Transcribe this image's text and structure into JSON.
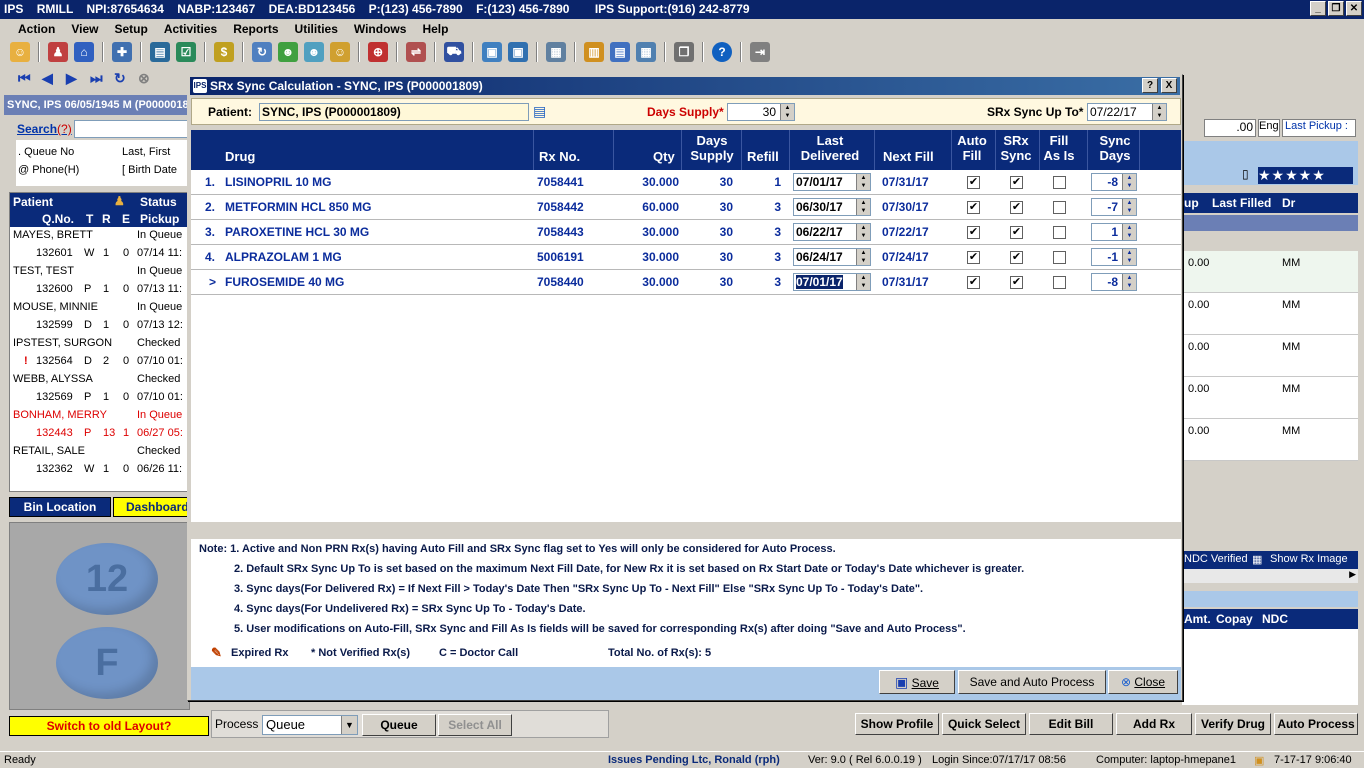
{
  "app": {
    "title_segments": [
      "IPS",
      "RMILL",
      "NPI:87654634",
      "NABP:123467",
      "DEA:BD123456",
      "P:(123) 456-7890",
      "F:(123) 456-7890",
      "IPS Support:(916) 242-8779"
    ],
    "menu": [
      "Action",
      "View",
      "Setup",
      "Activities",
      "Reports",
      "Utilities",
      "Windows",
      "Help"
    ],
    "patient_bar": "SYNC, IPS  06/05/1945 M  (P000001809)",
    "search_label": "Search",
    "search_qmark": "(?)",
    "search_options": [
      ". Queue No",
      "Last, First",
      "@ Phone(H)",
      "[ Birth Date"
    ],
    "patient_list_header": [
      "Patient",
      "Status"
    ],
    "patient_list_subheader": [
      "Q.No.",
      "T",
      "R",
      "E",
      "Pickup"
    ],
    "patients": [
      {
        "name": "MAYES, BRETT",
        "status": "In Queue",
        "qno": "132601",
        "t": "W",
        "r": "1",
        "e": "0",
        "pickup": "07/14 11:",
        "red": false
      },
      {
        "name": "TEST, TEST",
        "status": "In Queue",
        "qno": "132600",
        "t": "P",
        "r": "1",
        "e": "0",
        "pickup": "07/13 11:",
        "red": false
      },
      {
        "name": "MOUSE, MINNIE",
        "status": "In Queue",
        "qno": "132599",
        "t": "D",
        "r": "1",
        "e": "0",
        "pickup": "07/13 12:",
        "red": false
      },
      {
        "name": "IPSTEST, SURGON",
        "status": "Checked",
        "qno": "132564",
        "t": "D",
        "r": "2",
        "e": "0",
        "pickup": "07/10 01:",
        "red": false
      },
      {
        "name": "WEBB, ALYSSA",
        "status": "Checked",
        "qno": "132569",
        "t": "P",
        "r": "1",
        "e": "0",
        "pickup": "07/10 01:",
        "red": false
      },
      {
        "name": "BONHAM, MERRY",
        "status": "In Queue",
        "qno": "132443",
        "t": "P",
        "r": "13",
        "e": "1",
        "pickup": "06/27 05:",
        "red": true
      },
      {
        "name": "RETAIL, SALE",
        "status": "Checked",
        "qno": "132362",
        "t": "W",
        "r": "1",
        "e": "0",
        "pickup": "06/26 11:",
        "red": false
      }
    ],
    "bin_location": "Bin Location",
    "dashboard": "Dashboard",
    "pill_text_top": "12",
    "pill_text_bottom": "F",
    "switch_layout": "Switch to old Layout?",
    "process_label": "Process",
    "process_value": "Queue",
    "queue_button": "Queue",
    "select_all_button": "Select All",
    "bottom_buttons": [
      "Show Profile",
      "Quick Select",
      "Edit Bill",
      "Add Rx",
      "Verify Drug",
      "Auto Process"
    ],
    "right_panel": {
      "amount": ".00",
      "eng": "Eng",
      "last_pickup": "Last Pickup :",
      "headers": [
        "up",
        "Last Filled",
        "Dr"
      ],
      "rows": [
        [
          "0.00",
          "MM"
        ],
        [
          "0.00",
          "MM"
        ],
        [
          "0.00",
          "MM"
        ],
        [
          "0.00",
          "MM"
        ],
        [
          "0.00",
          "MM"
        ]
      ],
      "ndc_verified": "NDC Verified",
      "show_rx_image": "Show Rx Image",
      "lower_headers": [
        "Amt.",
        "Copay",
        "NDC"
      ]
    },
    "status": {
      "ready": "Ready",
      "issues": "Issues Pending Ltc, Ronald (rph)",
      "version": "Ver: 9.0 ( Rel 6.0.0.19 )",
      "login": "Login Since:07/17/17 08:56",
      "computer": "Computer: laptop-hmepane1",
      "datetime": "7-17-17 9:06:40"
    }
  },
  "dialog": {
    "title": "SRx Sync Calculation - SYNC, IPS  (P000001809)",
    "help_btn": "?",
    "close_btn": "X",
    "patient_label": "Patient:",
    "patient_value": "SYNC, IPS  (P000001809)",
    "days_supply_label": "Days Supply*",
    "days_supply_value": "30",
    "sync_up_to_label": "SRx Sync Up To*",
    "sync_up_to_value": "07/22/17",
    "columns": {
      "drug": "Drug",
      "rxno": "Rx No.",
      "qty": "Qty",
      "days_supply_1": "Days",
      "days_supply_2": "Supply",
      "refill": "Refill",
      "last_1": "Last",
      "last_2": "Delivered",
      "next_fill": "Next Fill",
      "auto_1": "Auto",
      "auto_2": "Fill",
      "srx_1": "SRx",
      "srx_2": "Sync",
      "fill_1": "Fill",
      "fill_2": "As Is",
      "sync_1": "Sync",
      "sync_2": "Days"
    },
    "rows": [
      {
        "idx": "1.",
        "drug": "LISINOPRIL 10 MG",
        "rxno": "7058441",
        "qty": "30.000",
        "days": "30",
        "refill": "1",
        "last": "07/01/17",
        "next": "07/31/17",
        "auto": true,
        "srx": true,
        "asis": false,
        "sync": "-8"
      },
      {
        "idx": "2.",
        "drug": "METFORMIN HCL 850 MG",
        "rxno": "7058442",
        "qty": "60.000",
        "days": "30",
        "refill": "3",
        "last": "06/30/17",
        "next": "07/30/17",
        "auto": true,
        "srx": true,
        "asis": false,
        "sync": "-7"
      },
      {
        "idx": "3.",
        "drug": "PAROXETINE HCL 30 MG",
        "rxno": "7058443",
        "qty": "30.000",
        "days": "30",
        "refill": "3",
        "last": "06/22/17",
        "next": "07/22/17",
        "auto": true,
        "srx": true,
        "asis": false,
        "sync": "1"
      },
      {
        "idx": "4.",
        "drug": "ALPRAZOLAM 1 MG",
        "rxno": "5006191",
        "qty": "30.000",
        "days": "30",
        "refill": "3",
        "last": "06/24/17",
        "next": "07/24/17",
        "auto": true,
        "srx": true,
        "asis": false,
        "sync": "-1"
      },
      {
        "idx": ">",
        "drug": "FUROSEMIDE 40 MG",
        "rxno": "7058440",
        "qty": "30.000",
        "days": "30",
        "refill": "3",
        "last": "07/01/17",
        "next": "07/31/17",
        "auto": true,
        "srx": true,
        "asis": false,
        "sync": "-8"
      }
    ],
    "notes": [
      "Note: 1. Active and Non PRN Rx(s) having Auto Fill and SRx Sync flag set to Yes will only be considered for Auto Process.",
      "2. Default SRx Sync Up To is set based on the maximum Next Fill Date, for New Rx it is set based on Rx Start Date or Today's Date whichever is greater.",
      "3. Sync days(For Delivered Rx) = If Next Fill > Today's Date Then \"SRx Sync Up To - Next Fill\" Else \"SRx Sync Up To - Today's Date\".",
      "4. Sync days(For Undelivered Rx) = SRx Sync Up To - Today's Date.",
      "5. User modifications on Auto-Fill, SRx Sync and Fill As Is fields will be saved for corresponding Rx(s) after doing \"Save and Auto Process\"."
    ],
    "legend_expired": "Expired Rx",
    "legend_not_verified": "* Not Verified Rx(s)",
    "legend_doctor": "C = Doctor Call",
    "total_label": "Total No. of Rx(s): 5",
    "save_btn": "Save",
    "save_auto_btn": "Save and Auto Process",
    "close_dialog_btn": "Close"
  },
  "colors": {
    "header_navy": "#0a2a7a",
    "row_text_blue": "#0b2c9c",
    "days_supply_red": "#cc0000",
    "footer_blue": "#aac8e8"
  }
}
